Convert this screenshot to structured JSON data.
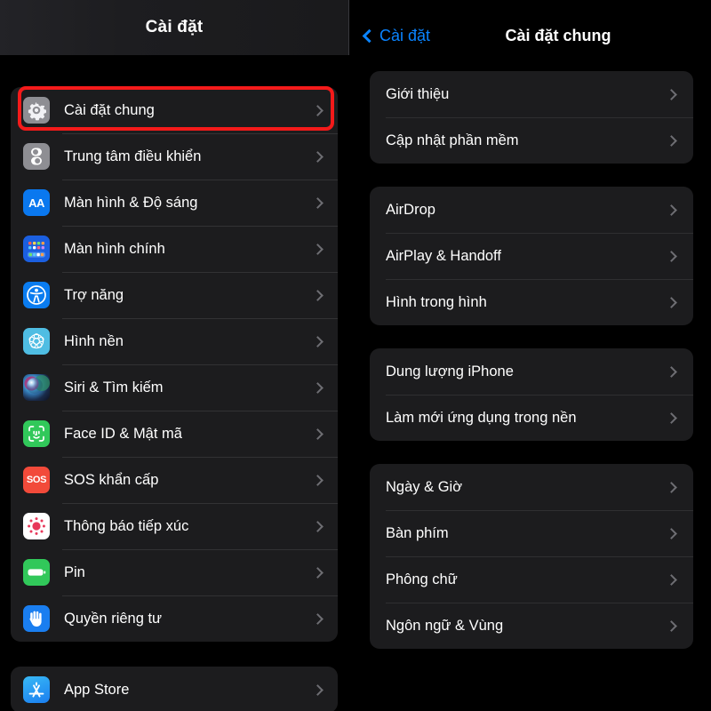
{
  "left_panel": {
    "header_title": "Cài đặt",
    "highlighted_item": "Cài đặt chung",
    "groups": [
      {
        "items": [
          {
            "label": "Cài đặt chung",
            "icon": "gear-icon",
            "highlighted": true
          },
          {
            "label": "Trung tâm điều khiển",
            "icon": "control-center-icon",
            "highlighted": false
          },
          {
            "label": "Màn hình & Độ sáng",
            "icon": "display-brightness-icon",
            "highlighted": false
          },
          {
            "label": "Màn hình chính",
            "icon": "home-screen-icon",
            "highlighted": false
          },
          {
            "label": "Trợ năng",
            "icon": "accessibility-icon",
            "highlighted": false
          },
          {
            "label": "Hình nền",
            "icon": "wallpaper-icon",
            "highlighted": false
          },
          {
            "label": "Siri & Tìm kiếm",
            "icon": "siri-icon",
            "highlighted": false
          },
          {
            "label": "Face ID & Mật mã",
            "icon": "face-id-icon",
            "highlighted": false
          },
          {
            "label": "SOS khẩn cấp",
            "icon": "sos-icon",
            "highlighted": false
          },
          {
            "label": "Thông báo tiếp xúc",
            "icon": "exposure-notification-icon",
            "highlighted": false
          },
          {
            "label": "Pin",
            "icon": "battery-icon",
            "highlighted": false
          },
          {
            "label": "Quyền riêng tư",
            "icon": "privacy-hand-icon",
            "highlighted": false
          }
        ]
      },
      {
        "items": [
          {
            "label": "App Store",
            "icon": "app-store-icon",
            "highlighted": false
          }
        ]
      }
    ]
  },
  "right_panel": {
    "back_label": "Cài đặt",
    "title": "Cài đặt chung",
    "groups": [
      {
        "items": [
          {
            "label": "Giới thiệu"
          },
          {
            "label": "Cập nhật phần mềm"
          }
        ]
      },
      {
        "items": [
          {
            "label": "AirDrop"
          },
          {
            "label": "AirPlay & Handoff"
          },
          {
            "label": "Hình trong hình"
          }
        ]
      },
      {
        "items": [
          {
            "label": "Dung lượng iPhone"
          },
          {
            "label": "Làm mới ứng dụng trong nền"
          }
        ]
      },
      {
        "items": [
          {
            "label": "Ngày & Giờ"
          },
          {
            "label": "Bàn phím"
          },
          {
            "label": "Phông chữ"
          },
          {
            "label": "Ngôn ngữ & Vùng"
          }
        ]
      }
    ]
  },
  "colors": {
    "accent_blue": "#0a84ff",
    "highlight_red": "#f41a1a",
    "card_background": "#1c1c1e",
    "page_background": "#000000",
    "chevron_gray": "#6e6e73",
    "text_primary": "#ffffff"
  }
}
